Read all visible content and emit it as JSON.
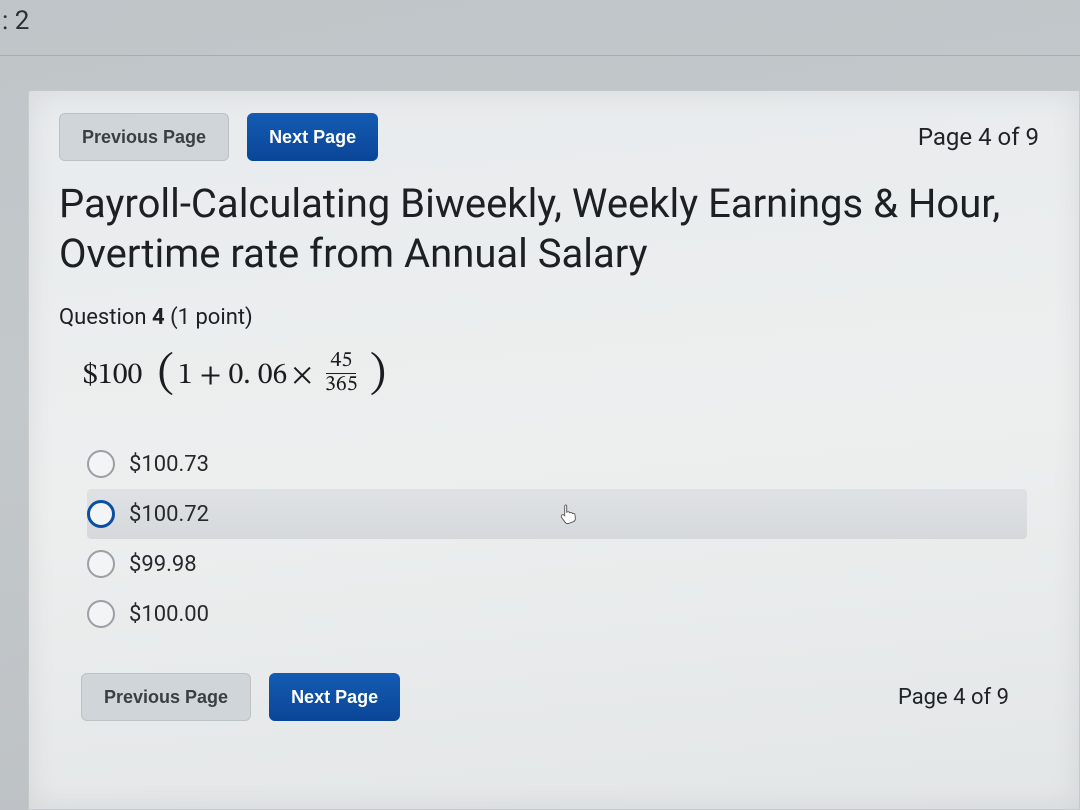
{
  "corner_label": ": 2",
  "nav": {
    "prev_label": "Previous Page",
    "next_label": "Next Page",
    "page_indicator": "Page 4 of 9"
  },
  "title": "Payroll-Calculating Biweekly, Weekly Earnings & Hour, Overtime rate from Annual Salary",
  "question": {
    "prefix": "Question",
    "number": "4",
    "points": "(1 point)"
  },
  "formula": {
    "lead": "$100",
    "lparen": "(",
    "inner1": "1 + 0. 06 ",
    "times": "×",
    "frac_num": "45",
    "frac_den": "365",
    "rparen": ")"
  },
  "options": [
    {
      "label": "$100.73",
      "hovered": false
    },
    {
      "label": "$100.72",
      "hovered": true
    },
    {
      "label": "$99.98",
      "hovered": false
    },
    {
      "label": "$100.00",
      "hovered": false
    }
  ],
  "bottom_nav": {
    "prev_label": "Previous Page",
    "next_label": "Next Page",
    "page_indicator": "Page 4 of 9"
  }
}
